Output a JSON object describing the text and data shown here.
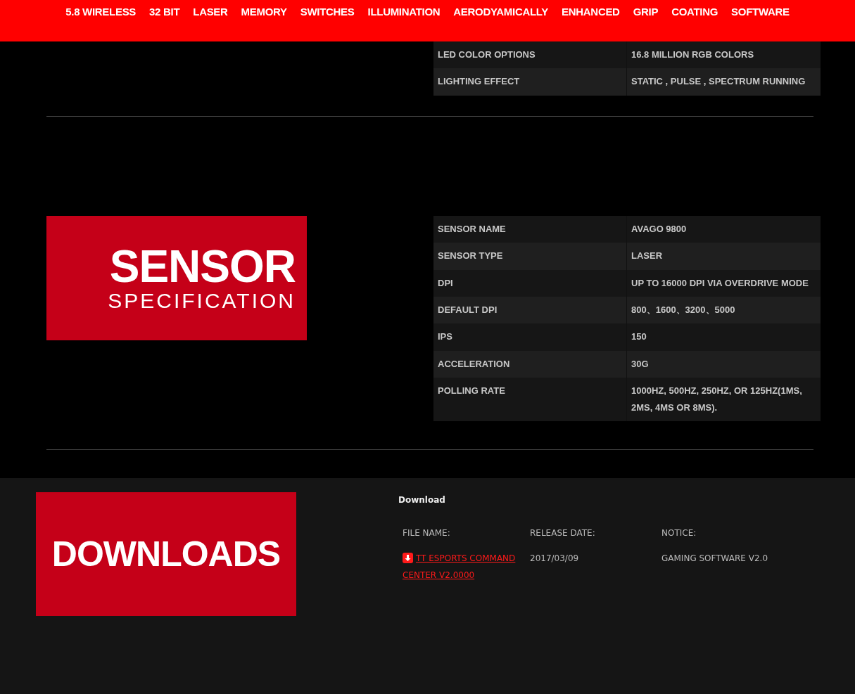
{
  "nav": {
    "items": [
      "5.8 WIRELESS",
      "32 BIT",
      "LASER",
      "MEMORY",
      "SWITCHES",
      "ILLUMINATION",
      "AERODYAMICALLY",
      "ENHANCED",
      "GRIP",
      "COATING",
      "SOFTWARE"
    ]
  },
  "lighting_table": {
    "rows": [
      {
        "label": "LED COLOR OPTIONS",
        "value": "16.8 MILLION RGB COLORS"
      },
      {
        "label": "LIGHTING EFFECT",
        "value": "STATIC , PULSE , SPECTRUM RUNNING"
      }
    ]
  },
  "sensor": {
    "banner": {
      "title": "SENSOR",
      "subtitle": "SPECIFICATION"
    },
    "rows": [
      {
        "label": "SENSOR NAME",
        "value": "AVAGO 9800"
      },
      {
        "label": "SENSOR TYPE",
        "value": "LASER"
      },
      {
        "label": "DPI",
        "value": "UP TO 16000 DPI VIA OVERDRIVE MODE"
      },
      {
        "label": "DEFAULT DPI",
        "value": "800、1600、3200、5000"
      },
      {
        "label": "IPS",
        "value": "150"
      },
      {
        "label": "ACCELERATION",
        "value": "30G"
      },
      {
        "label": "POLLING RATE",
        "value": "1000HZ, 500HZ, 250HZ, OR 125HZ(1MS, 2MS, 4MS OR 8MS)."
      }
    ]
  },
  "downloads": {
    "banner": "DOWNLOADS",
    "heading": "Download",
    "columns": [
      "FILE NAME:",
      "RELEASE DATE:",
      "NOTICE:"
    ],
    "rows": [
      {
        "file_name": "TT ESPORTS COMMAND CENTER V2.0000",
        "release_date": "2017/03/09",
        "notice": "GAMING SOFTWARE V2.0"
      }
    ]
  }
}
